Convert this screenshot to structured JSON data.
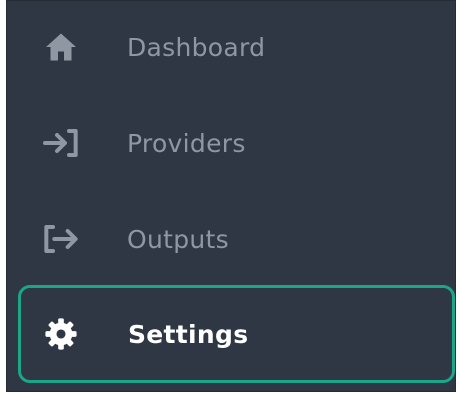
{
  "nav": {
    "items": [
      {
        "label": "Dashboard",
        "icon": "home-icon",
        "active": false
      },
      {
        "label": "Providers",
        "icon": "login-arrow-icon",
        "active": false
      },
      {
        "label": "Outputs",
        "icon": "logout-arrow-icon",
        "active": false
      },
      {
        "label": "Settings",
        "icon": "gear-icon",
        "active": true
      }
    ]
  },
  "colors": {
    "background": "#2f3744",
    "inactive_text": "#8f97a3",
    "active_text": "#ffffff",
    "active_border": "#1ba68a"
  }
}
